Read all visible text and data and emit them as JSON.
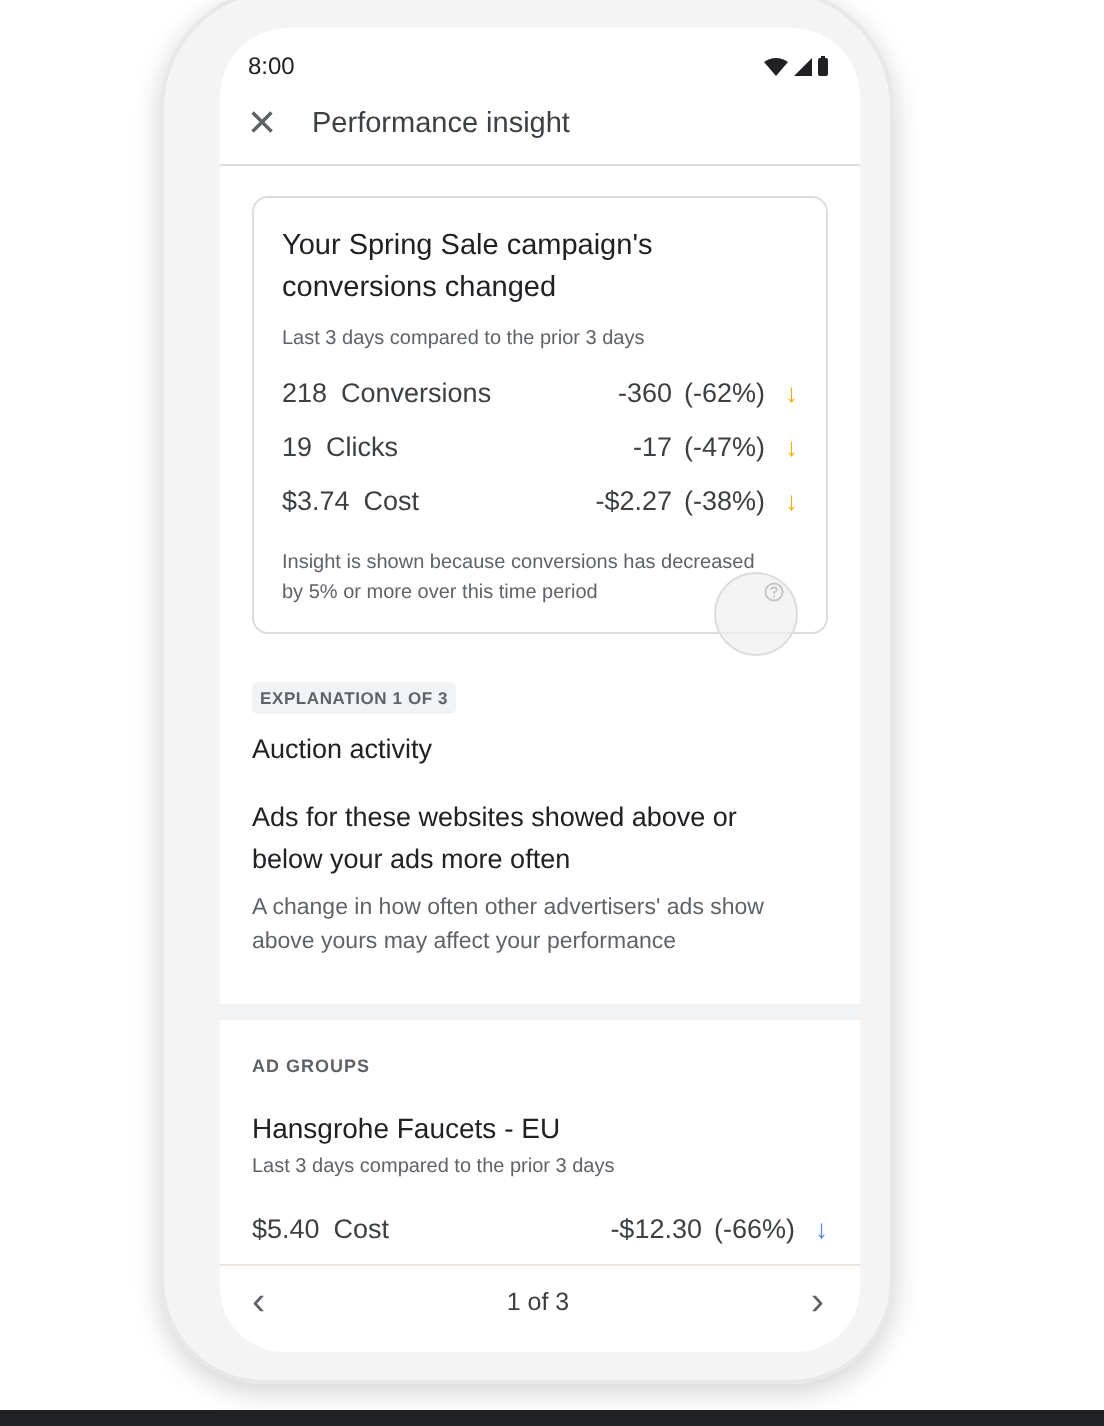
{
  "status_bar": {
    "time": "8:00"
  },
  "app_bar": {
    "close_icon": "×",
    "title": "Performance insight"
  },
  "insight_card": {
    "title": "Your Spring Sale campaign's conversions changed",
    "subtitle": "Last 3 days compared to the prior 3 days",
    "metrics": [
      {
        "value": "218",
        "label": "Conversions",
        "change": "-360",
        "percent": "(-62%)",
        "arrow": "↓",
        "color": "#f9ab00"
      },
      {
        "value": "19",
        "label": "Clicks",
        "change": "-17",
        "percent": "(-47%)",
        "arrow": "↓",
        "color": "#f9ab00"
      },
      {
        "value": "$3.74",
        "label": "Cost",
        "change": "-$2.27",
        "percent": "(-38%)",
        "arrow": "↓",
        "color": "#f9ab00"
      }
    ],
    "note": "Insight is shown because conversions has decreased by 5% or more over this time period"
  },
  "explanation": {
    "badge": "EXPLANATION 1 OF 3",
    "title": "Auction activity",
    "heading": "Ads for these websites showed above or below your ads more often",
    "body": "A change in how often other advertisers' ads show above yours may affect your performance"
  },
  "ad_groups": {
    "label": "AD GROUPS",
    "name": "Hansgrohe Faucets - EU",
    "subtitle": "Last 3 days compared to the prior 3 days",
    "metrics": [
      {
        "value": "$5.40",
        "label": "Cost",
        "change": "-$12.30",
        "percent": "(-66%)",
        "arrow": "↓",
        "color": "#4285f4"
      }
    ]
  },
  "pager": {
    "prev": "‹",
    "label": "1 of 3",
    "next": "›"
  }
}
